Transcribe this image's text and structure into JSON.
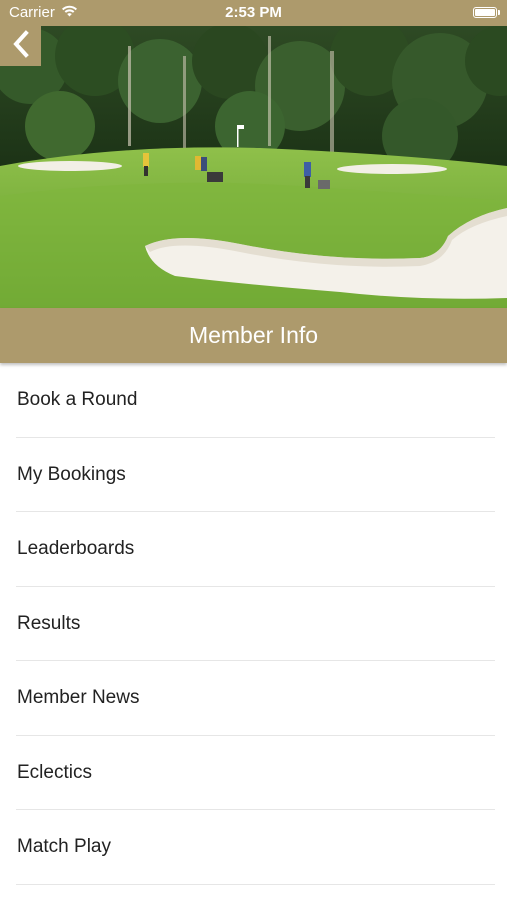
{
  "status_bar": {
    "carrier": "Carrier",
    "time": "2:53 PM",
    "wifi_icon": "wifi-icon",
    "battery_icon": "battery-icon"
  },
  "nav": {
    "back_icon": "chevron-left-icon"
  },
  "hero": {
    "image": "golf-course-photo"
  },
  "title": "Member Info",
  "menu": {
    "items": [
      {
        "label": "Book a Round"
      },
      {
        "label": "My Bookings"
      },
      {
        "label": "Leaderboards"
      },
      {
        "label": "Results"
      },
      {
        "label": "Member News"
      },
      {
        "label": "Eclectics"
      },
      {
        "label": "Match Play"
      }
    ]
  },
  "colors": {
    "accent": "#ad9a6c",
    "text": "#222222",
    "divider": "#e6e6e6"
  }
}
